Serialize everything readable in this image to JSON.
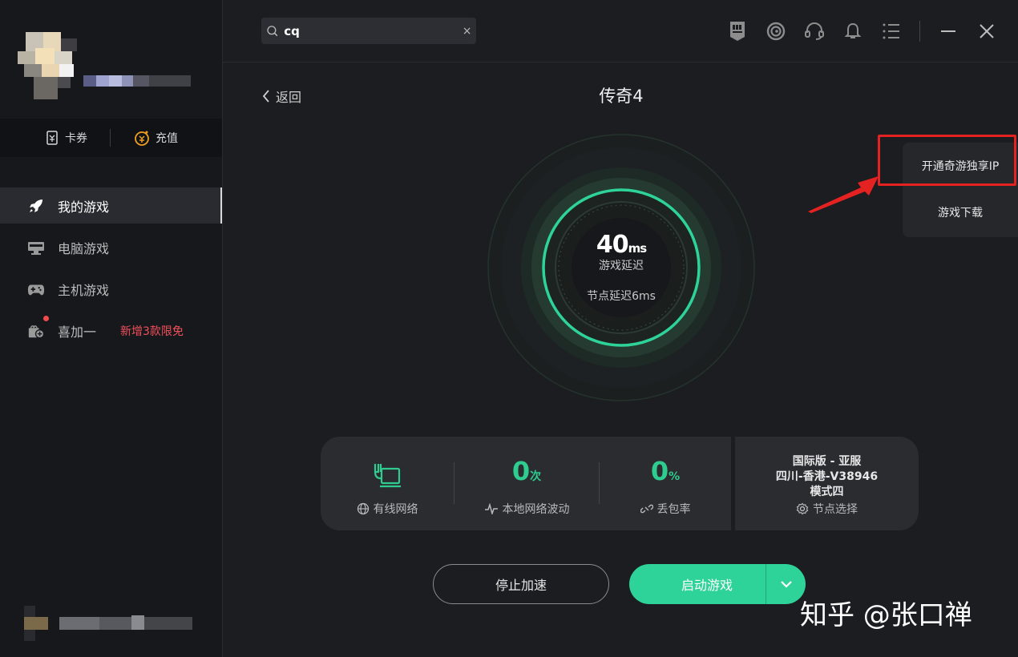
{
  "wallet": {
    "coupon_label": "卡券",
    "recharge_label": "充值"
  },
  "sidebar": {
    "items": [
      {
        "label": "我的游戏",
        "icon": "rocket-icon"
      },
      {
        "label": "电脑游戏",
        "icon": "pc-icon"
      },
      {
        "label": "主机游戏",
        "icon": "gamepad-icon"
      },
      {
        "label": "喜加一",
        "icon": "gift-icon",
        "extra": "新增3款限免"
      }
    ]
  },
  "search": {
    "value": "cq",
    "clear": "×"
  },
  "header": {
    "back_label": "返回",
    "title": "传奇4"
  },
  "gauge": {
    "latency_value": "40",
    "latency_unit": "ms",
    "latency_label": "游戏延迟",
    "node_latency": "节点延迟6ms"
  },
  "popup": {
    "item1": "开通奇游独享IP",
    "item2": "游戏下载"
  },
  "stats": {
    "network_label": "有线网络",
    "fluctuation_value": "0",
    "fluctuation_unit": "次",
    "fluctuation_label": "本地网络波动",
    "loss_value": "0",
    "loss_unit": "%",
    "loss_label": "丢包率",
    "server_line1": "国际版 - 亚服",
    "server_line2": "四川-香港-V38946",
    "server_line3": "模式四",
    "node_select_label": "节点选择"
  },
  "buttons": {
    "stop": "停止加速",
    "start": "启动游戏"
  },
  "watermark": "知乎 @张口禅",
  "colors": {
    "accent": "#2ed39a",
    "warning": "#f0505a",
    "highlight": "#e52222"
  }
}
